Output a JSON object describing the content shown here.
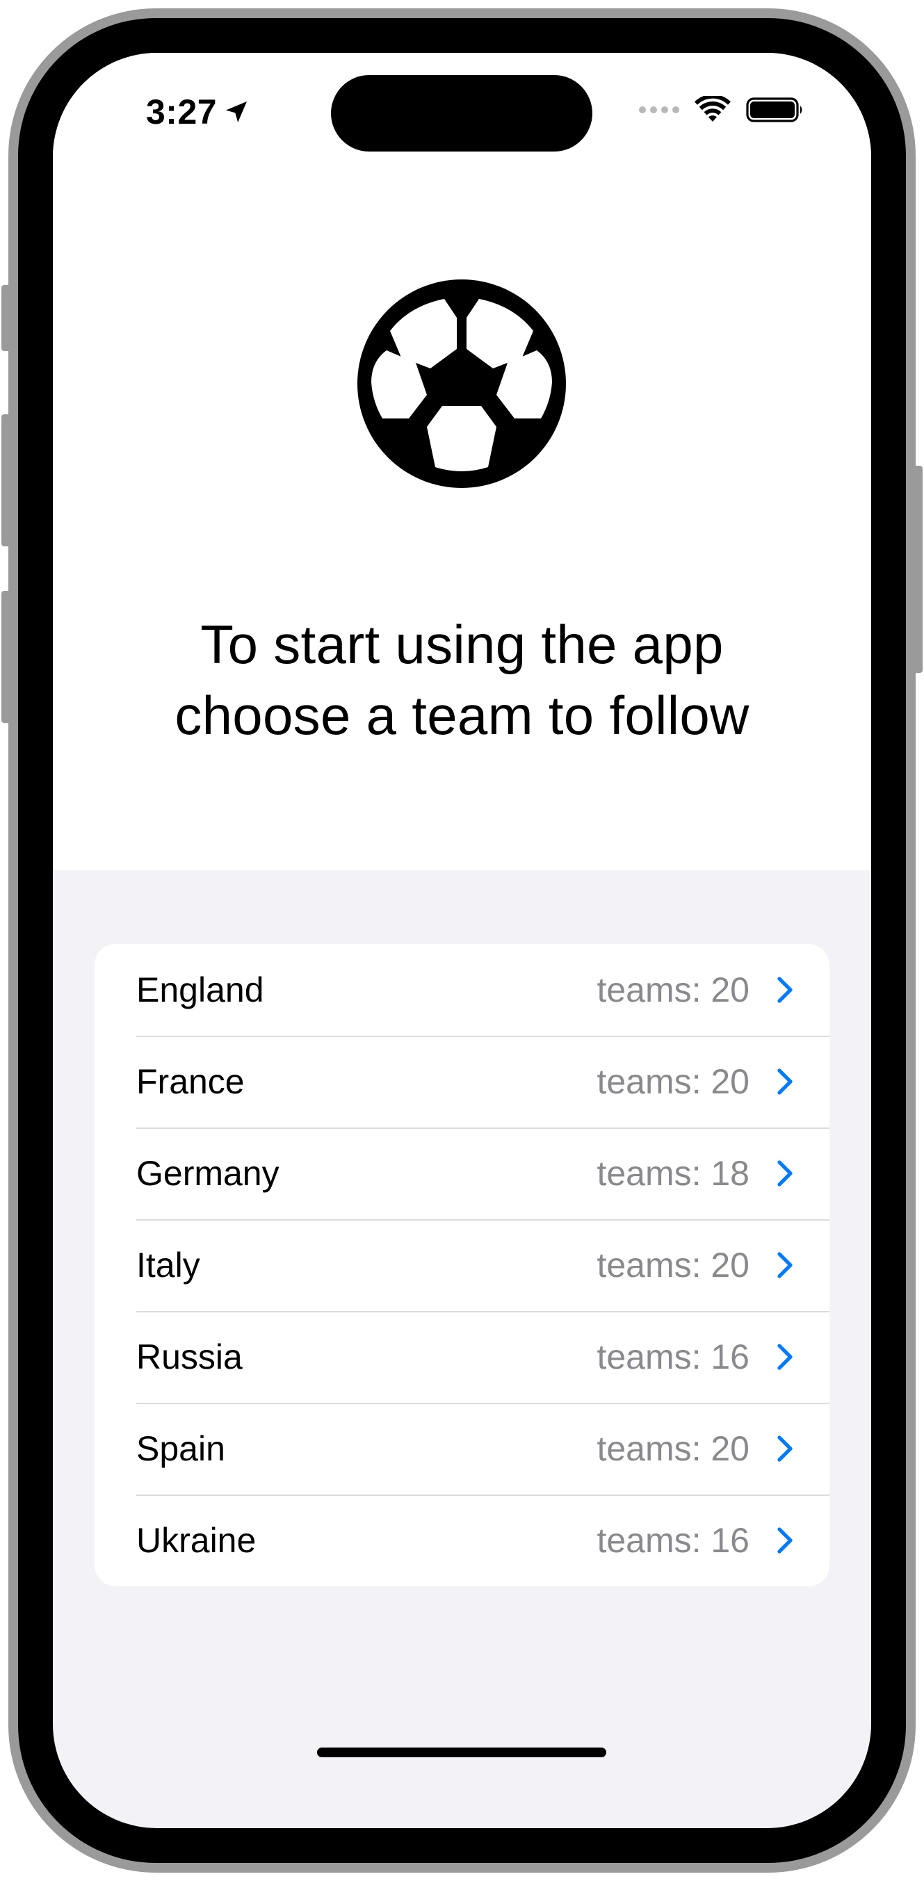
{
  "status_bar": {
    "time": "3:27",
    "location_icon": "location-arrow-icon",
    "wifi_icon": "wifi-icon",
    "battery_icon": "battery-icon"
  },
  "hero": {
    "icon": "soccer-ball-icon",
    "headline_line1": "To start using the app",
    "headline_line2": "choose a team to follow"
  },
  "leagues": [
    {
      "name": "England",
      "count": "teams: 20"
    },
    {
      "name": "France",
      "count": "teams: 20"
    },
    {
      "name": "Germany",
      "count": "teams: 18"
    },
    {
      "name": "Italy",
      "count": "teams: 20"
    },
    {
      "name": "Russia",
      "count": "teams: 16"
    },
    {
      "name": "Spain",
      "count": "teams: 20"
    },
    {
      "name": "Ukraine",
      "count": "teams: 16"
    }
  ],
  "colors": {
    "accent": "#007aff",
    "secondary_text": "#8a8a8e",
    "grouped_background": "#f2f2f7"
  }
}
